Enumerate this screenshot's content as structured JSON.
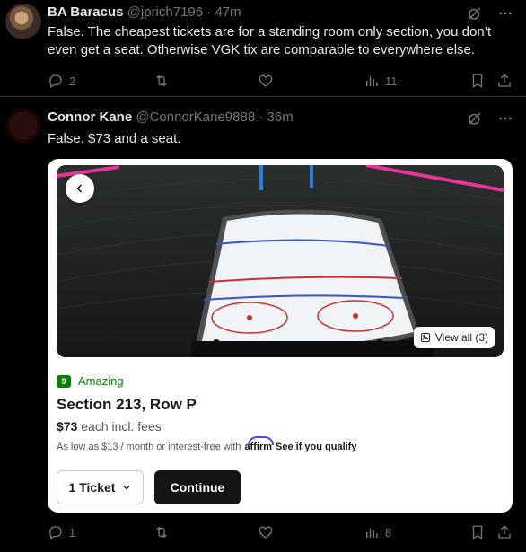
{
  "tweets": [
    {
      "author": "BA Baracus",
      "handle": "@jprich7196",
      "separator": "·",
      "time": "47m",
      "text": "False.  The cheapest tickets are for a standing room only section, you don’t even get a seat.  Otherwise VGK tix are comparable to everywhere else.",
      "stats": {
        "replies": "2",
        "retweets": "",
        "likes": "",
        "views": "11"
      }
    },
    {
      "author": "Connor Kane",
      "handle": "@ConnorKane9888",
      "separator": "·",
      "time": "36m",
      "text": "False. $73 and a seat.",
      "stats": {
        "replies": "1",
        "retweets": "",
        "likes": "",
        "views": "8"
      }
    }
  ],
  "card": {
    "view_all": "View all (3)",
    "rating_score": "9",
    "rating_label": "Amazing",
    "section": "Section 213, Row P",
    "price": "$73",
    "price_suffix": "each incl. fees",
    "finance_text": "As low as $13 / month or interest-free with",
    "finance_brand": "affirm",
    "finance_link": "See if you qualify",
    "ticket_qty": "1 Ticket",
    "continue_label": "Continue"
  },
  "icons": {
    "grok": "grok-icon",
    "more": "more-icon",
    "reply": "reply-icon",
    "retweet": "retweet-icon",
    "like": "like-icon",
    "views": "views-icon",
    "bookmark": "bookmark-icon",
    "share": "share-icon"
  },
  "colors": {
    "background": "#000000",
    "muted": "#71767b",
    "rating_green": "#107c10",
    "affirm_blue": "#4a4af4"
  }
}
